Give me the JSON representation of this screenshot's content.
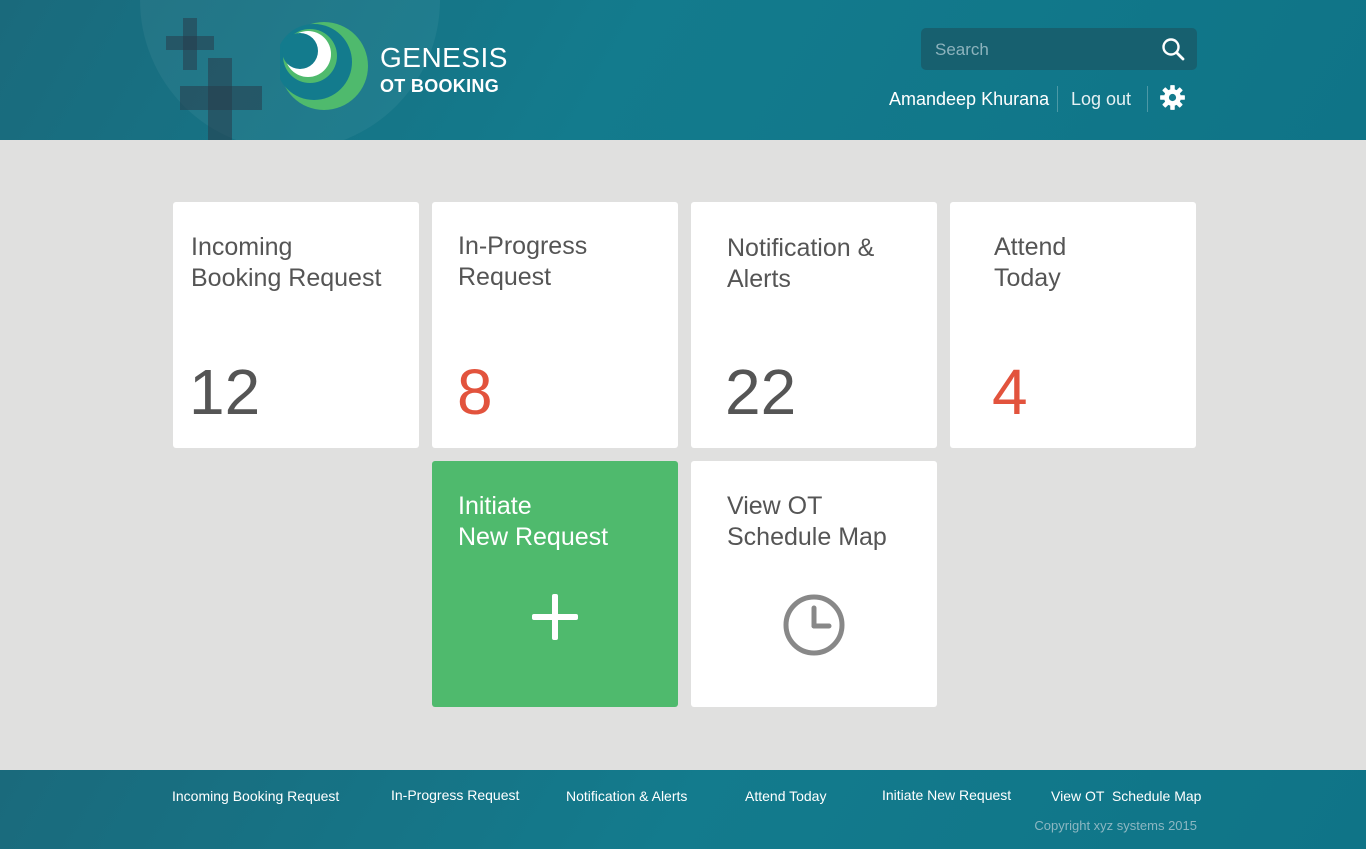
{
  "header": {
    "brand_name": "GENESIS",
    "brand_sub": "OT BOOKING",
    "search_placeholder": "Search",
    "user_name": "Amandeep Khurana",
    "logout_label": "Log out"
  },
  "tiles": [
    {
      "title": "Incoming\nBooking Request",
      "count": "12"
    },
    {
      "title": "In-Progress\nRequest",
      "count": "8"
    },
    {
      "title": "Notification &\nAlerts",
      "count": "22"
    },
    {
      "title": "Attend\nToday",
      "count": "4"
    },
    {
      "title": "Initiate\nNew Request",
      "icon": "plus-icon"
    },
    {
      "title": "View OT\nSchedule Map",
      "icon": "clock-icon"
    }
  ],
  "footer": {
    "links": [
      "Incoming Booking Request",
      "In-Progress Request",
      "Notification & Alerts",
      "Attend Today",
      "Initiate New Request",
      "View OT  Schedule Map"
    ],
    "copyright": "Copyright xyz systems 2015"
  },
  "colors": {
    "header_teal": "#137b8d",
    "accent_red": "#e2533d",
    "accent_green": "#4fba6d",
    "tile_text": "#555555",
    "background": "#e0e0df"
  }
}
